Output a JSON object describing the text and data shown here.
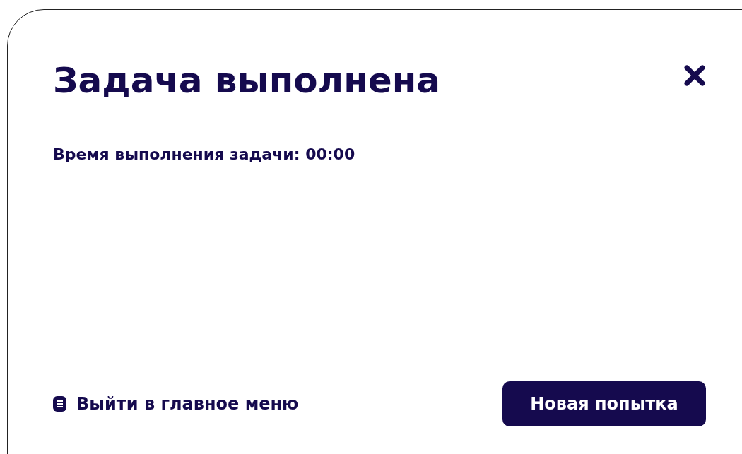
{
  "dialog": {
    "title": "Задача выполнена",
    "message": "Время выполнения задачи: 00:00",
    "exit_link": "Выйти в главное меню",
    "retry_button": "Новая попытка"
  }
}
